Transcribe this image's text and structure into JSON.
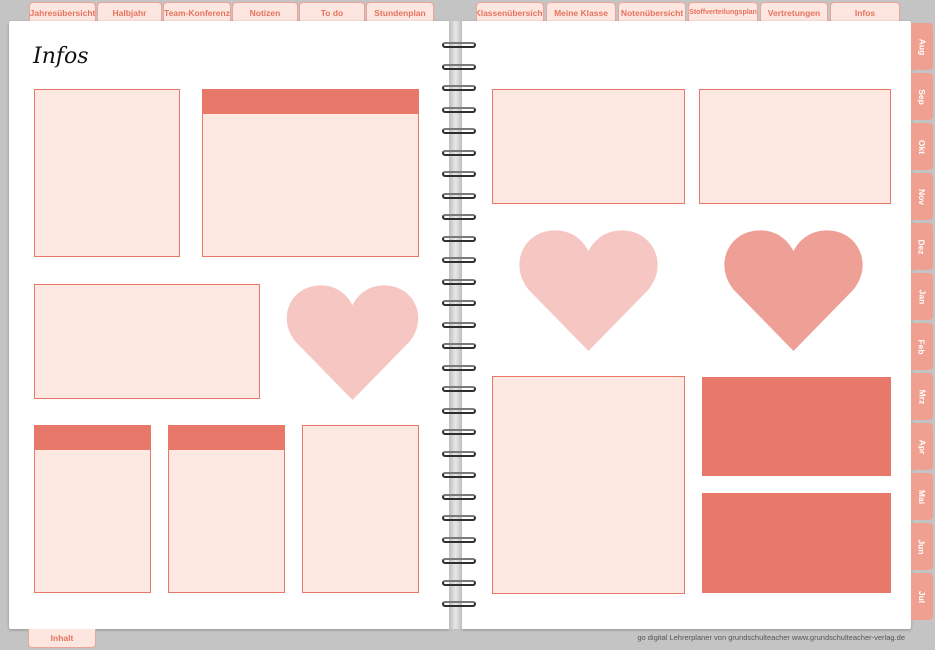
{
  "top_tabs_left": [
    {
      "label": "Jahresübersicht"
    },
    {
      "label": "Halbjahr"
    },
    {
      "label": "Team-Konferenz"
    },
    {
      "label": "Notizen"
    },
    {
      "label": "To do"
    },
    {
      "label": "Stundenplan"
    }
  ],
  "top_tabs_right": [
    {
      "label": "Klassenübersicht"
    },
    {
      "label": "Meine Klasse"
    },
    {
      "label": "Notenübersicht"
    },
    {
      "label": "Stoffverteilungsplan"
    },
    {
      "label": "Vertretungen"
    },
    {
      "label": "Infos"
    }
  ],
  "page_title": "Infos",
  "months": [
    "Aug",
    "Sep",
    "Okt",
    "Nov",
    "Dez",
    "Jan",
    "Feb",
    "Mrz",
    "Apr",
    "Mai",
    "Jun",
    "Jul"
  ],
  "bottom_tab": "Inhalt",
  "footer": "go digital Lehrerplaner von grundschulteacher www.grundschulteacher-verlag.de",
  "colors": {
    "accent": "#e8786a",
    "box_fill": "#fee9e2",
    "heart_light": "#f5c6c2",
    "heart_medium": "#eea097",
    "tab_fill": "#fde6df",
    "side_tab": "#f0a091"
  }
}
